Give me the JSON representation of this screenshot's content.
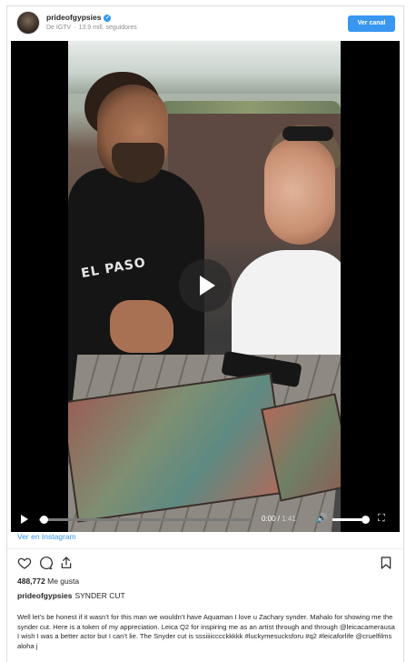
{
  "header": {
    "username": "prideofgypsies",
    "source": "De IGTV",
    "followers": "13.9 mill. seguidores",
    "view_channel_label": "Ver canal"
  },
  "video": {
    "shirt_text": "EL PASO",
    "current_time": "0:00",
    "duration": "1:41",
    "progress": 0.0,
    "volume": 0.8
  },
  "links": {
    "view_on_instagram": "Ver en Instagram"
  },
  "post": {
    "likes_count": "488,772",
    "likes_label": "Me gusta",
    "caption_user": "prideofgypsies",
    "caption_title": "SYNDER CUT",
    "caption_body": "Well let’s be honest if it wasn’t for this man we wouldn’t have Aquaman I love u Zachary synder. Mahalo for showing me the synder cut. Here is a token of my appreciation. Leica Q2 for inspiring me as an artist through and through @leicacamerausa I wish I was a better actor but I can’t lie. The Snyder cut is sssiiiicccckkkkk #luckymesucksforu #q2 #leicaforlife @cruelfilms aloha j"
  },
  "colors": {
    "accent": "#3897f0",
    "text": "#262626",
    "muted": "#8e8e8e"
  }
}
